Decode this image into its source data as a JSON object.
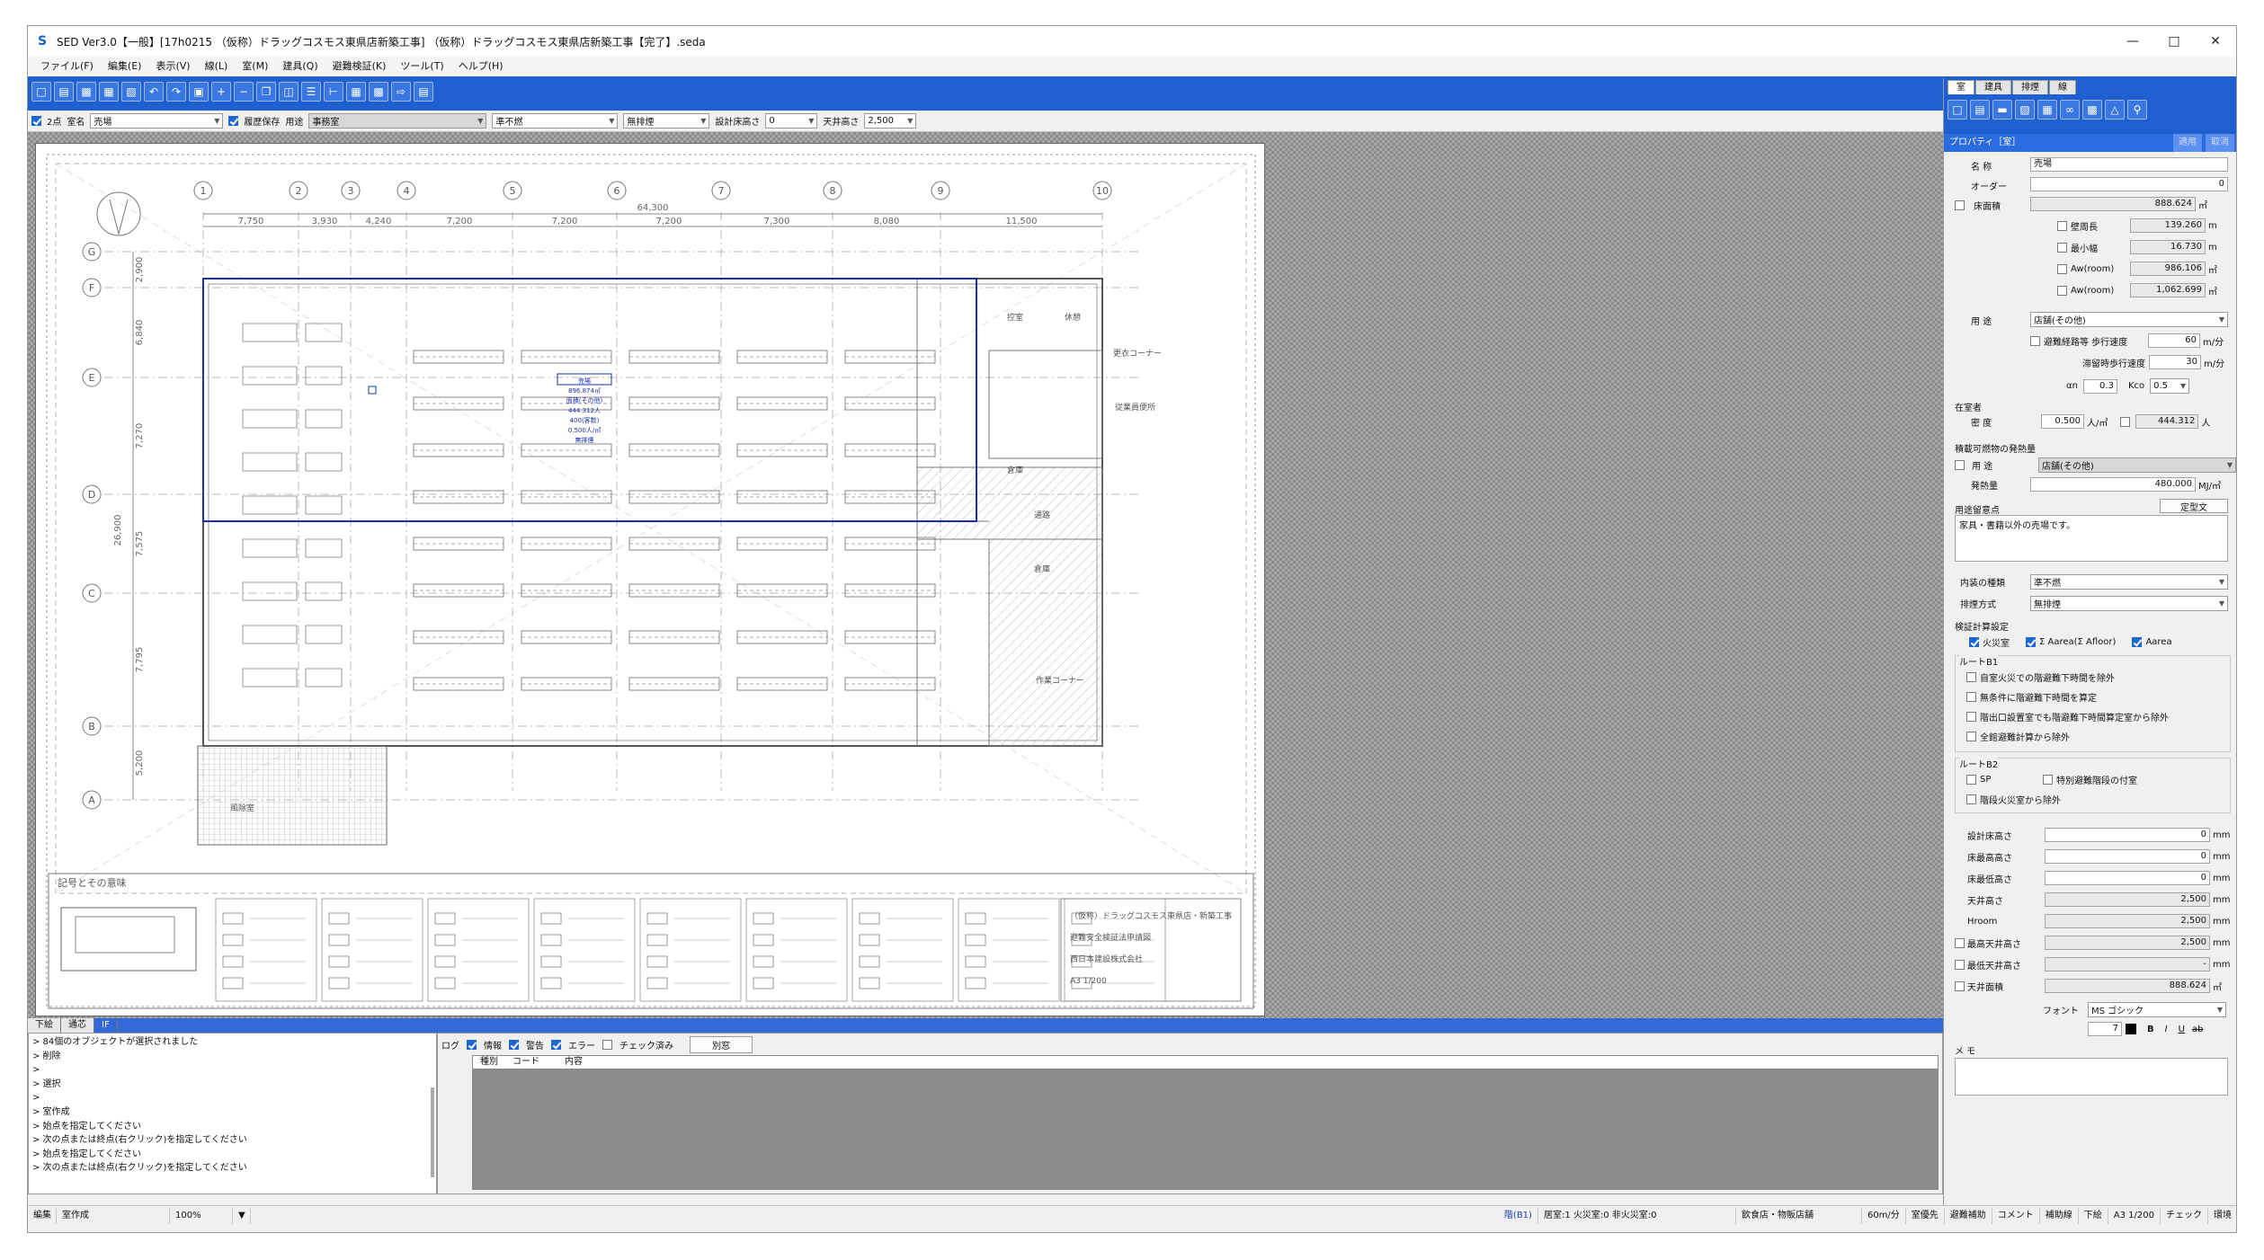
{
  "window": {
    "title": "SED Ver3.0【一般】[17h0215 （仮称）ドラッグコスモス東県店新築工事] （仮称）ドラッグコスモス東県店新築工事【完了】.seda",
    "min_icon": "minimize-icon",
    "max_icon": "maximize-icon",
    "close_icon": "close-icon"
  },
  "menu": [
    "ファイル(F)",
    "編集(E)",
    "表示(V)",
    "線(L)",
    "室(M)",
    "建具(Q)",
    "避難検証(K)",
    "ツール(T)",
    "ヘルプ(H)"
  ],
  "propbar": {
    "twopoint": "2点",
    "room_name_label": "室名",
    "room_name": "売場",
    "history_save": "履歴保存",
    "use_label": "用途",
    "use_value": "事務室",
    "finish": "準不燃",
    "smoke": "無排煙",
    "floor_height_label": "設計床高さ",
    "floor_height": "0",
    "ceiling_height_label": "天井高さ",
    "ceiling_height": "2,500"
  },
  "drawing": {
    "grid_cols": [
      "1",
      "2",
      "3",
      "4",
      "5",
      "6",
      "7",
      "8",
      "9",
      "10"
    ],
    "grid_rows": [
      "G",
      "F",
      "E",
      "D",
      "C",
      "B",
      "A"
    ],
    "top_dims": [
      "7,750",
      "3,930",
      "4,240",
      "7,200",
      "7,200",
      "7,200",
      "7,300",
      "8,080",
      "11,500"
    ],
    "total_dim": "64,300",
    "left_dims": [
      "2,900",
      "6,840",
      "7,270",
      "7,575",
      "7,795",
      "5,200"
    ],
    "total_left_dim": "26,900",
    "room_tag": [
      "売場",
      "896.874㎡",
      "面積(その他)",
      "444.312人",
      "400(客数)",
      "0.500人/㎡",
      "無排煙"
    ],
    "room_labels": [
      "控室",
      "休憩",
      "更衣コーナー",
      "従業員便所",
      "倉庫",
      "通路",
      "倉庫",
      "風除室",
      "作業コーナー"
    ],
    "title_block": [
      "（仮称）ドラッグコスモス東県店・新築工事",
      "避難安全検証法申請図",
      "西日本建設株式会社",
      "A3 1/200"
    ],
    "legend_title": "記号とその意味"
  },
  "bottom_tabs": [
    "下絵",
    "通芯",
    "IF"
  ],
  "command_log": [
    "> 84個のオブジェクトが選択されました",
    "> 削除",
    ">",
    "> 選択",
    ">",
    "> 室作成",
    "> 始点を指定してください",
    "> 次の点または終点(右クリック)を指定してください",
    "> 始点を指定してください",
    "> 次の点または終点(右クリック)を指定してください"
  ],
  "log_panel": {
    "label": "ログ",
    "info": "情報",
    "warn": "警告",
    "error": "エラー",
    "checked": "チェック済み",
    "separate_window": "別窓",
    "columns": [
      "種別",
      "コード",
      "内容"
    ]
  },
  "statusbar": [
    "編集",
    "室作成",
    "100%",
    "▼",
    "階(B1)",
    "居室:1 火災室:0 非火災室:0",
    "飲食店・物販店舗",
    "60m/分",
    "室優先",
    "避難補助",
    "コメント",
    "補助線",
    "下絵",
    "A3 1/200",
    "チェック",
    "環境"
  ],
  "panel": {
    "tabs": [
      "室",
      "建具",
      "排煙",
      "線"
    ],
    "title": "プロパティ［室］",
    "title_btns": [
      "適用",
      "取消"
    ],
    "name_label": "名 称",
    "name": "売場",
    "order_label": "オーダー",
    "order": "0",
    "floor_area_label": "床面積",
    "floor_area": "888.624",
    "sqm": "㎡",
    "m": "m",
    "wall_len_label": "壁周長",
    "wall_len": "139.260",
    "min_width_label": "最小幅",
    "min_width": "16.730",
    "aw_room_label1": "Aw(room)",
    "aw_room1": "986.106",
    "aw_room_label2": "Aw(room)",
    "aw_room2": "1,062.699",
    "use_label": "用 途",
    "use": "店舗(その他)",
    "evac_speed_label": "避難経路等 歩行速度",
    "evac_speed": "60",
    "mpm": "m/分",
    "stay_speed_label": "滞留時歩行速度",
    "stay_speed": "30",
    "an_label": "αn",
    "an": "0.3",
    "kco_label": "Kco",
    "kco": "0.5",
    "occupant_title": "在室者",
    "density_label": "密 度",
    "density": "0.500",
    "ppsqm": "人/㎡",
    "people": "444.312",
    "nin": "人",
    "combustible_title": "積載可燃物の発熱量",
    "comb_use_label": "用 途",
    "comb_use": "店舗(その他)",
    "heat_label": "発熱量",
    "heat": "480.000",
    "heat_unit": "MJ/㎡",
    "notes_title": "用途留意点",
    "fixed_text_btn": "定型文",
    "notes_text": "家具・書籍以外の売場です。",
    "interior_label": "内装の種類",
    "interior": "準不燃",
    "smoke_label": "排煙方式",
    "smoke": "無排煙",
    "calc_title": "検証計算設定",
    "fire_room": "火災室",
    "sum_area": "Σ Aarea(Σ Afloor)",
    "aarea": "Aarea",
    "route_b1": "ルートB1",
    "b1_opts": [
      "自室火災での階避難下時間を除外",
      "無条件に階避難下時間を算定",
      "階出口設置室でも階避難下時間算定室から除外",
      "全館避難計算から除外"
    ],
    "route_b2": "ルートB2",
    "b2_sp": "SP",
    "b2_special": "特別避難階段の付室",
    "b2_stair": "階段火災室から除外",
    "heights": [
      {
        "label": "設計床高さ",
        "value": "0",
        "unit": "mm"
      },
      {
        "label": "床最高高さ",
        "value": "0",
        "unit": "mm"
      },
      {
        "label": "床最低高さ",
        "value": "0",
        "unit": "mm"
      },
      {
        "label": "天井高さ",
        "value": "2,500",
        "unit": "mm"
      },
      {
        "label": "Hroom",
        "value": "2,500",
        "unit": "mm"
      },
      {
        "label": "最高天井高さ",
        "value": "2,500",
        "unit": "mm"
      },
      {
        "label": "最低天井高さ",
        "value": "-",
        "unit": "mm"
      },
      {
        "label": "天井面積",
        "value": "888.624",
        "unit": "㎡"
      }
    ],
    "font_label": "フォント",
    "font_value": "MS ゴシック",
    "font_size": "7",
    "bold": "B",
    "italic": "I",
    "underline": "U",
    "strike": "ab",
    "memo_label": "メ モ"
  },
  "colors": {
    "accent": "#1f5fd0",
    "selection": "#1a2fb0"
  }
}
